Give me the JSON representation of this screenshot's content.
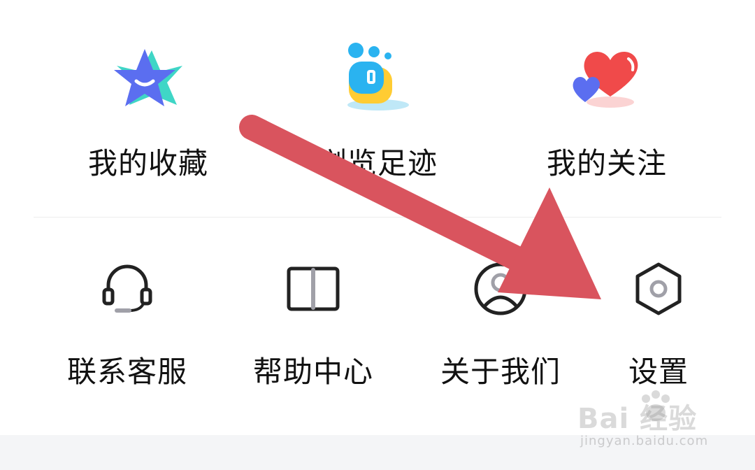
{
  "top_row": [
    {
      "label": "我的收藏",
      "icon": "star-icon"
    },
    {
      "label": "浏览足迹",
      "icon": "footprint-icon"
    },
    {
      "label": "我的关注",
      "icon": "hearts-icon"
    }
  ],
  "bottom_row": [
    {
      "label": "联系客服",
      "icon": "headset-icon"
    },
    {
      "label": "帮助中心",
      "icon": "book-icon"
    },
    {
      "label": "关于我们",
      "icon": "user-circle-icon"
    },
    {
      "label": "设置",
      "icon": "gear-icon"
    }
  ],
  "watermark": {
    "logo": "Bai  经验",
    "url": "jingyan.baidu.com"
  },
  "colors": {
    "arrow": "#d9545e",
    "star": "#5b6ef0",
    "star_accent": "#3fd6c6",
    "heart": "#f04a4a",
    "heart_small": "#5b6ef0",
    "foot_blue": "#2ab3f0",
    "foot_yellow": "#ffcc33"
  }
}
